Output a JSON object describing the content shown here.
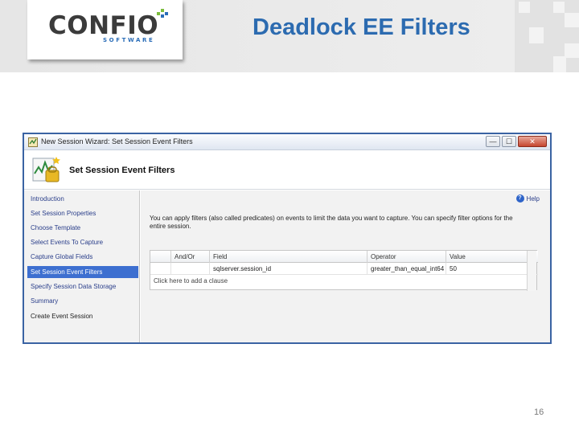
{
  "slide": {
    "title": "Deadlock EE Filters",
    "page_number": "16"
  },
  "logo": {
    "word": "CONFIO",
    "sub": "SOFTWARE"
  },
  "window": {
    "title": "New Session Wizard: Set Session Event Filters",
    "controls": {
      "minimize": "—",
      "maximize": "☐",
      "close": "✕"
    },
    "header_title": "Set Session Event Filters",
    "help_label": "Help",
    "nav": [
      {
        "label": "Introduction",
        "selected": false
      },
      {
        "label": "Set Session Properties",
        "selected": false
      },
      {
        "label": "Choose Template",
        "selected": false
      },
      {
        "label": "Select Events To Capture",
        "selected": false
      },
      {
        "label": "Capture Global Fields",
        "selected": false
      },
      {
        "label": "Set Session Event Filters",
        "selected": true
      },
      {
        "label": "Specify Session Data Storage",
        "selected": false
      },
      {
        "label": "Summary",
        "selected": false
      },
      {
        "label": "Create Event Session",
        "selected": false
      }
    ],
    "description": "You can apply filters (also called predicates) on events to limit the data you want to capture. You can specify filter options for the entire session.",
    "grid": {
      "columns": [
        "And/Or",
        "Field",
        "Operator",
        "Value"
      ],
      "rows": [
        {
          "and_or": "",
          "field": "sqlserver.session_id",
          "operator": "greater_than_equal_int64",
          "value": "50"
        }
      ],
      "add_clause": "Click here to add a clause"
    }
  },
  "colors": {
    "title_blue": "#2c6bb0",
    "selection_blue": "#3d6fd0",
    "window_border": "#3a63a3"
  }
}
